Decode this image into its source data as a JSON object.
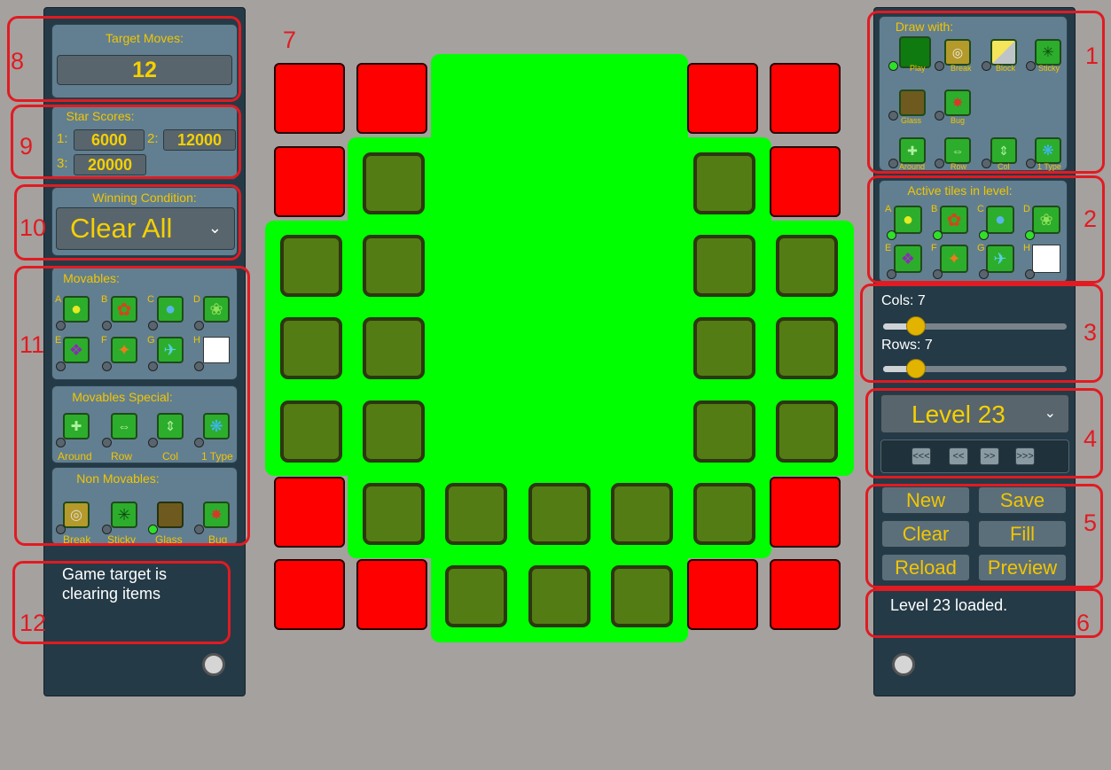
{
  "left": {
    "target_moves": {
      "title": "Target Moves:",
      "value": "12"
    },
    "star_scores": {
      "title": "Star Scores:",
      "l1": "1:",
      "v1": "6000",
      "l2": "2:",
      "v2": "12000",
      "l3": "3:",
      "v3": "20000"
    },
    "winning": {
      "title": "Winning Condition:",
      "value": "Clear All"
    },
    "movables": {
      "title": "Movables:",
      "letters": [
        "A",
        "B",
        "C",
        "D",
        "E",
        "F",
        "G",
        "H"
      ]
    },
    "movables_special": {
      "title": "Movables Special:",
      "items": [
        "Around",
        "Row",
        "Col",
        "1 Type"
      ]
    },
    "non_movables": {
      "title": "Non Movables:",
      "items": [
        "Break",
        "Sticky",
        "Glass",
        "Bug"
      ]
    },
    "info_text": "Game target is clearing items"
  },
  "right": {
    "draw_with": {
      "title": "Draw with:",
      "row1": [
        "Play",
        "Break",
        "Block",
        "Sticky"
      ],
      "row2": [
        "Glass",
        "Bug"
      ],
      "row3": [
        "Around",
        "Row",
        "Col",
        "1 Type"
      ]
    },
    "active_tiles": {
      "title": "Active tiles in level:",
      "letters": [
        "A",
        "B",
        "C",
        "D",
        "E",
        "F",
        "G",
        "H"
      ]
    },
    "cols_label": "Cols: 7",
    "rows_label": "Rows: 7",
    "level_select": "Level 23",
    "nav": [
      "<<<",
      "<<",
      ">>",
      ">>>"
    ],
    "buttons": {
      "new": "New",
      "save": "Save",
      "clear": "Clear",
      "fill": "Fill",
      "reload": "Reload",
      "preview": "Preview"
    },
    "status": "Level 23 loaded."
  },
  "annotations": [
    "1",
    "2",
    "3",
    "4",
    "5",
    "6",
    "7",
    "8",
    "9",
    "10",
    "11",
    "12"
  ],
  "colors": {
    "accent": "#f2c500",
    "panel": "#243a47",
    "board_green": "#00ff00",
    "red_tile": "#ff0000",
    "olive_tile": "#547c14",
    "annotation": "#e11b22"
  }
}
